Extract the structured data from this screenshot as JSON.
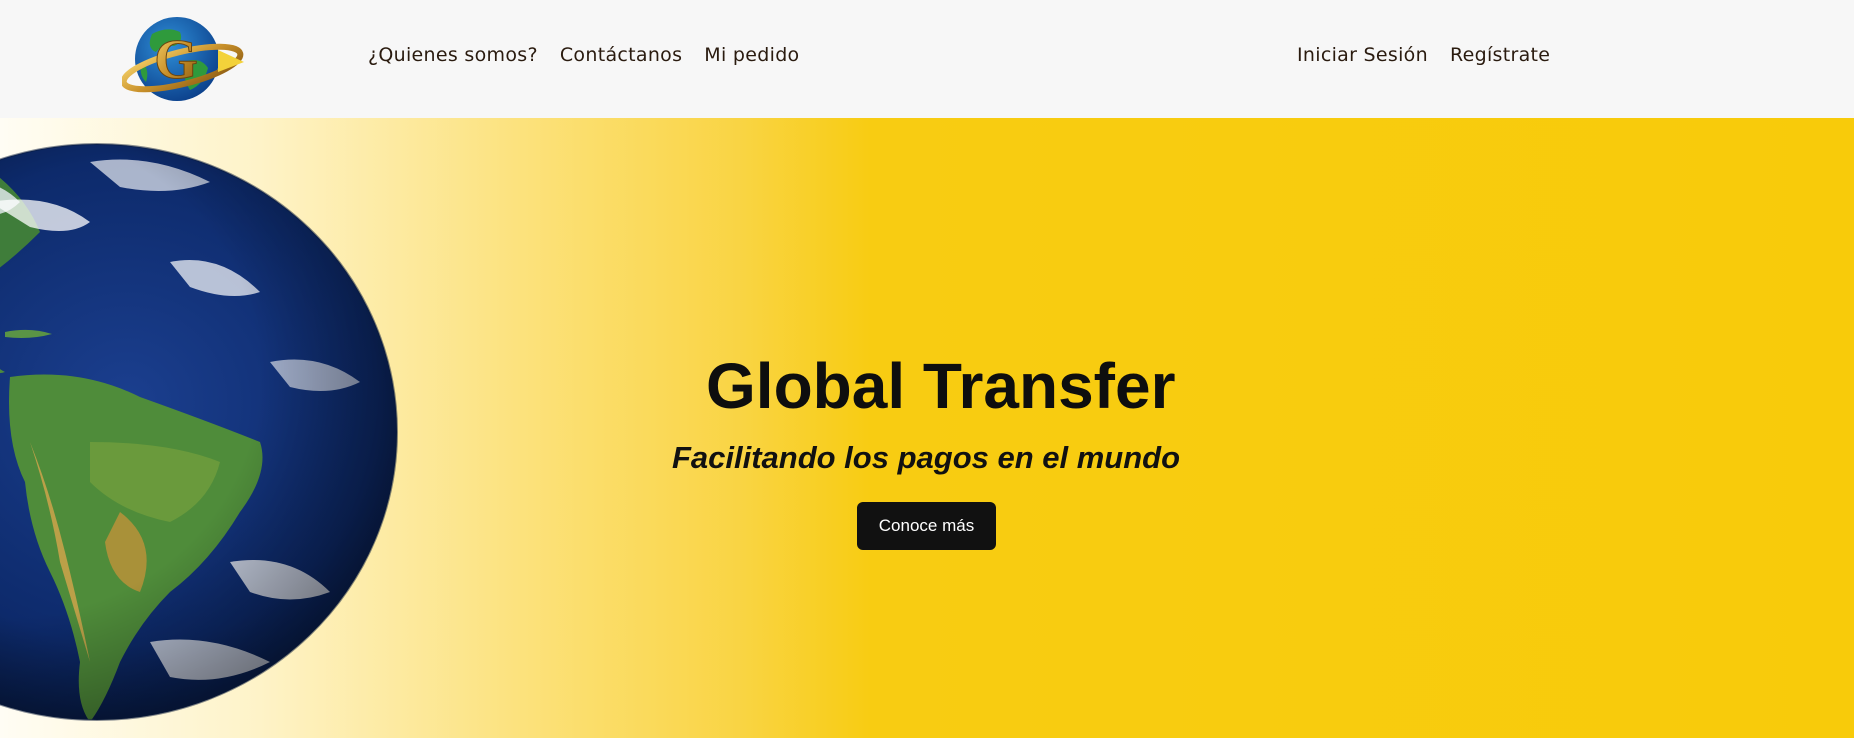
{
  "navbar": {
    "logo_letter": "G",
    "links_left": [
      {
        "label": "¿Quienes somos?"
      },
      {
        "label": "Contáctanos"
      },
      {
        "label": "Mi pedido"
      }
    ],
    "links_right": [
      {
        "label": "Iniciar Sesión"
      },
      {
        "label": "Regístrate"
      }
    ]
  },
  "hero": {
    "title": "Global Transfer",
    "subtitle": "Facilitando los pagos en el mundo",
    "cta_label": "Conoce más"
  },
  "colors": {
    "nav_background": "#f7f7f7",
    "hero_yellow": "#f8cb0a",
    "button_dark": "#111111",
    "text_dark": "#2a1b0f"
  }
}
